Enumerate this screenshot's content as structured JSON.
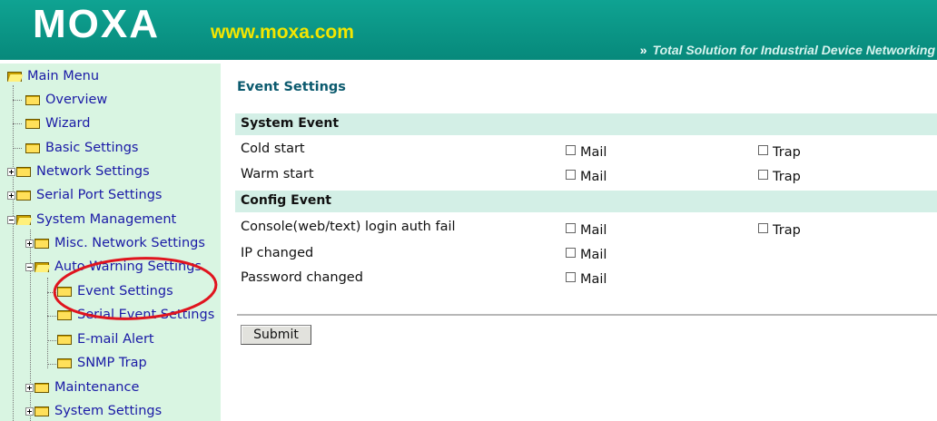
{
  "header": {
    "logo_text": "MOXA",
    "logo_url": "www.moxa.com",
    "tagline_chevron": "»",
    "tagline": "Total Solution for Industrial Device Networking",
    "bg_color": "#0a9a8a",
    "url_color": "#f4e600"
  },
  "sidebar": {
    "bg_color": "#d9f5e2",
    "items": [
      {
        "label": "Main Menu",
        "icon": "folder-open-icon"
      },
      {
        "label": "Overview",
        "icon": "folder-icon"
      },
      {
        "label": "Wizard",
        "icon": "folder-icon"
      },
      {
        "label": "Basic Settings",
        "icon": "folder-icon"
      },
      {
        "label": "Network Settings",
        "icon": "folder-icon"
      },
      {
        "label": "Serial Port Settings",
        "icon": "folder-icon"
      },
      {
        "label": "System Management",
        "icon": "folder-open-icon"
      },
      {
        "label": "Misc. Network Settings",
        "icon": "folder-icon"
      },
      {
        "label": "Auto Warning Settings",
        "icon": "folder-open-icon"
      },
      {
        "label": "Event Settings",
        "icon": "folder-icon"
      },
      {
        "label": "Serial Event Settings",
        "icon": "folder-icon"
      },
      {
        "label": "E-mail Alert",
        "icon": "folder-icon"
      },
      {
        "label": "SNMP Trap",
        "icon": "folder-icon"
      },
      {
        "label": "Maintenance",
        "icon": "folder-icon"
      },
      {
        "label": "System Settings",
        "icon": "folder-icon"
      }
    ]
  },
  "main": {
    "title": "Event Settings",
    "sections": [
      {
        "title": "System Event",
        "rows": [
          {
            "label": "Cold start",
            "mail": "Mail",
            "trap": "Trap"
          },
          {
            "label": "Warm start",
            "mail": "Mail",
            "trap": "Trap"
          }
        ]
      },
      {
        "title": "Config Event",
        "rows": [
          {
            "label": "Console(web/text) login auth fail",
            "mail": "Mail",
            "trap": "Trap"
          },
          {
            "label": "IP changed",
            "mail": "Mail"
          },
          {
            "label": "Password changed",
            "mail": "Mail"
          }
        ]
      }
    ],
    "submit_label": "Submit"
  },
  "annotation": {
    "color": "#e0141e"
  }
}
